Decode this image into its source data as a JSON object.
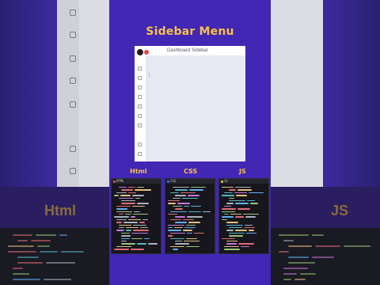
{
  "title": "Sidebar Menu",
  "preview": {
    "header_title": "Dashboard Sidebar",
    "cursor_text": "|",
    "sidebar_icons": [
      "home-icon",
      "search-icon",
      "chart-icon",
      "bell-icon",
      "heart-icon",
      "folder-icon",
      "settings-icon",
      "logout-icon"
    ]
  },
  "tabs": {
    "html_label": "Html",
    "css_label": "CSS",
    "js_label": "JS"
  },
  "editors": {
    "html_file": "HTML",
    "css_file": "CSS",
    "js_file": "JS"
  },
  "background": {
    "left_label": "Html",
    "right_label": "JS"
  },
  "colors": {
    "accent": "#f6c24a",
    "panel": "#4226b4",
    "toggle": "#e64646",
    "html_dot": "#e5532d",
    "css_dot": "#2d7ae5",
    "js_dot": "#f0d11c"
  }
}
